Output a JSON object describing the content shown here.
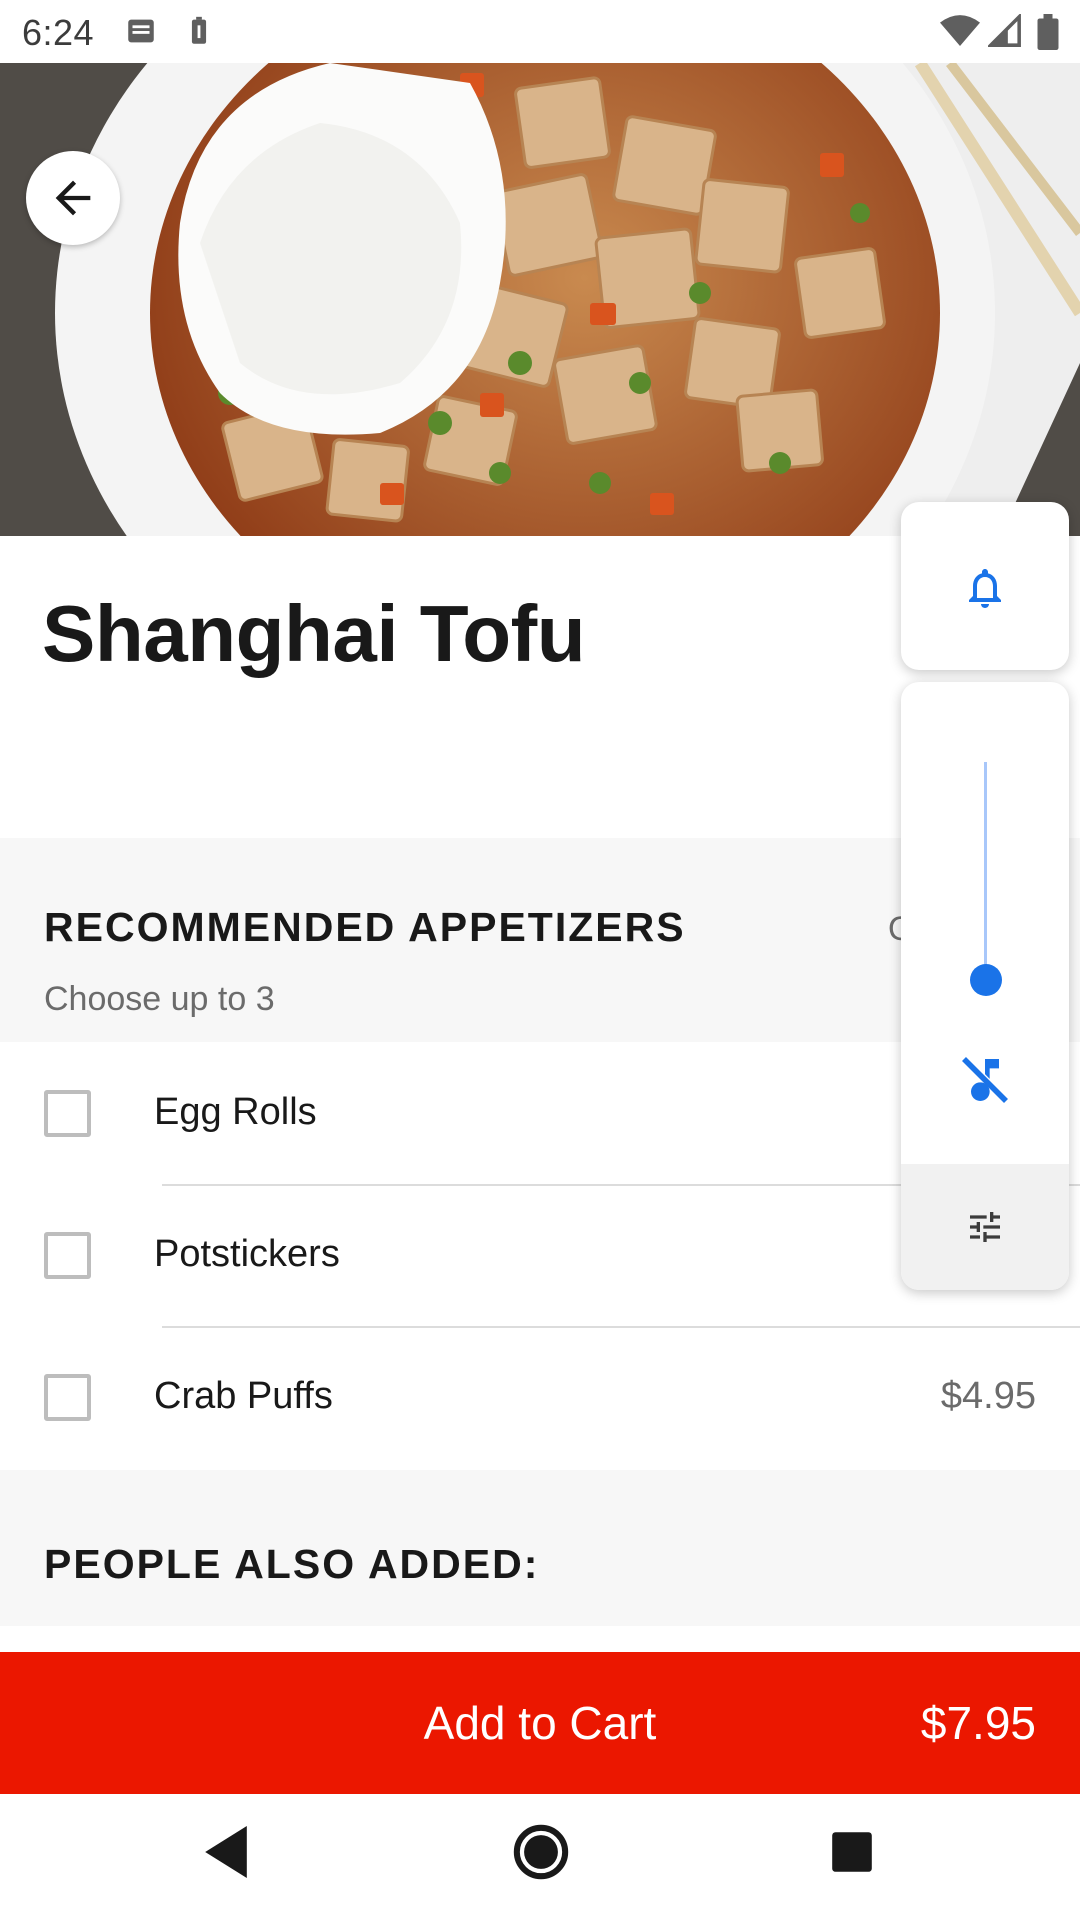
{
  "status_bar": {
    "time": "6:24",
    "icons": [
      "notification-icon",
      "battery-saver-icon",
      "wifi-icon",
      "signal-icon",
      "battery-icon"
    ]
  },
  "hero": {
    "image": "tofu-with-rice-photo",
    "back_icon": "arrow-back-icon"
  },
  "item": {
    "title": "Shanghai Tofu"
  },
  "appetizers": {
    "title": "RECOMMENDED APPETIZERS",
    "subtitle": "Choose up to 3",
    "right_text": "O",
    "options": [
      {
        "label": "Egg Rolls",
        "price": "",
        "checked": false
      },
      {
        "label": "Potstickers",
        "price": "",
        "checked": false
      },
      {
        "label": "Crab Puffs",
        "price": "$4.95",
        "checked": false
      }
    ]
  },
  "also_added": {
    "title": "PEOPLE ALSO ADDED:"
  },
  "cart": {
    "label": "Add to Cart",
    "price": "$7.95",
    "color": "#eb1700"
  },
  "volume_panel": {
    "ringer_icon": "bell-icon",
    "level": 0.1,
    "mute_icon": "music-note-off-icon",
    "settings_icon": "tune-icon",
    "accent": "#1a73e8"
  },
  "nav_bar": {
    "back": "triangle-back-icon",
    "home": "circle-home-icon",
    "recents": "square-recents-icon"
  }
}
